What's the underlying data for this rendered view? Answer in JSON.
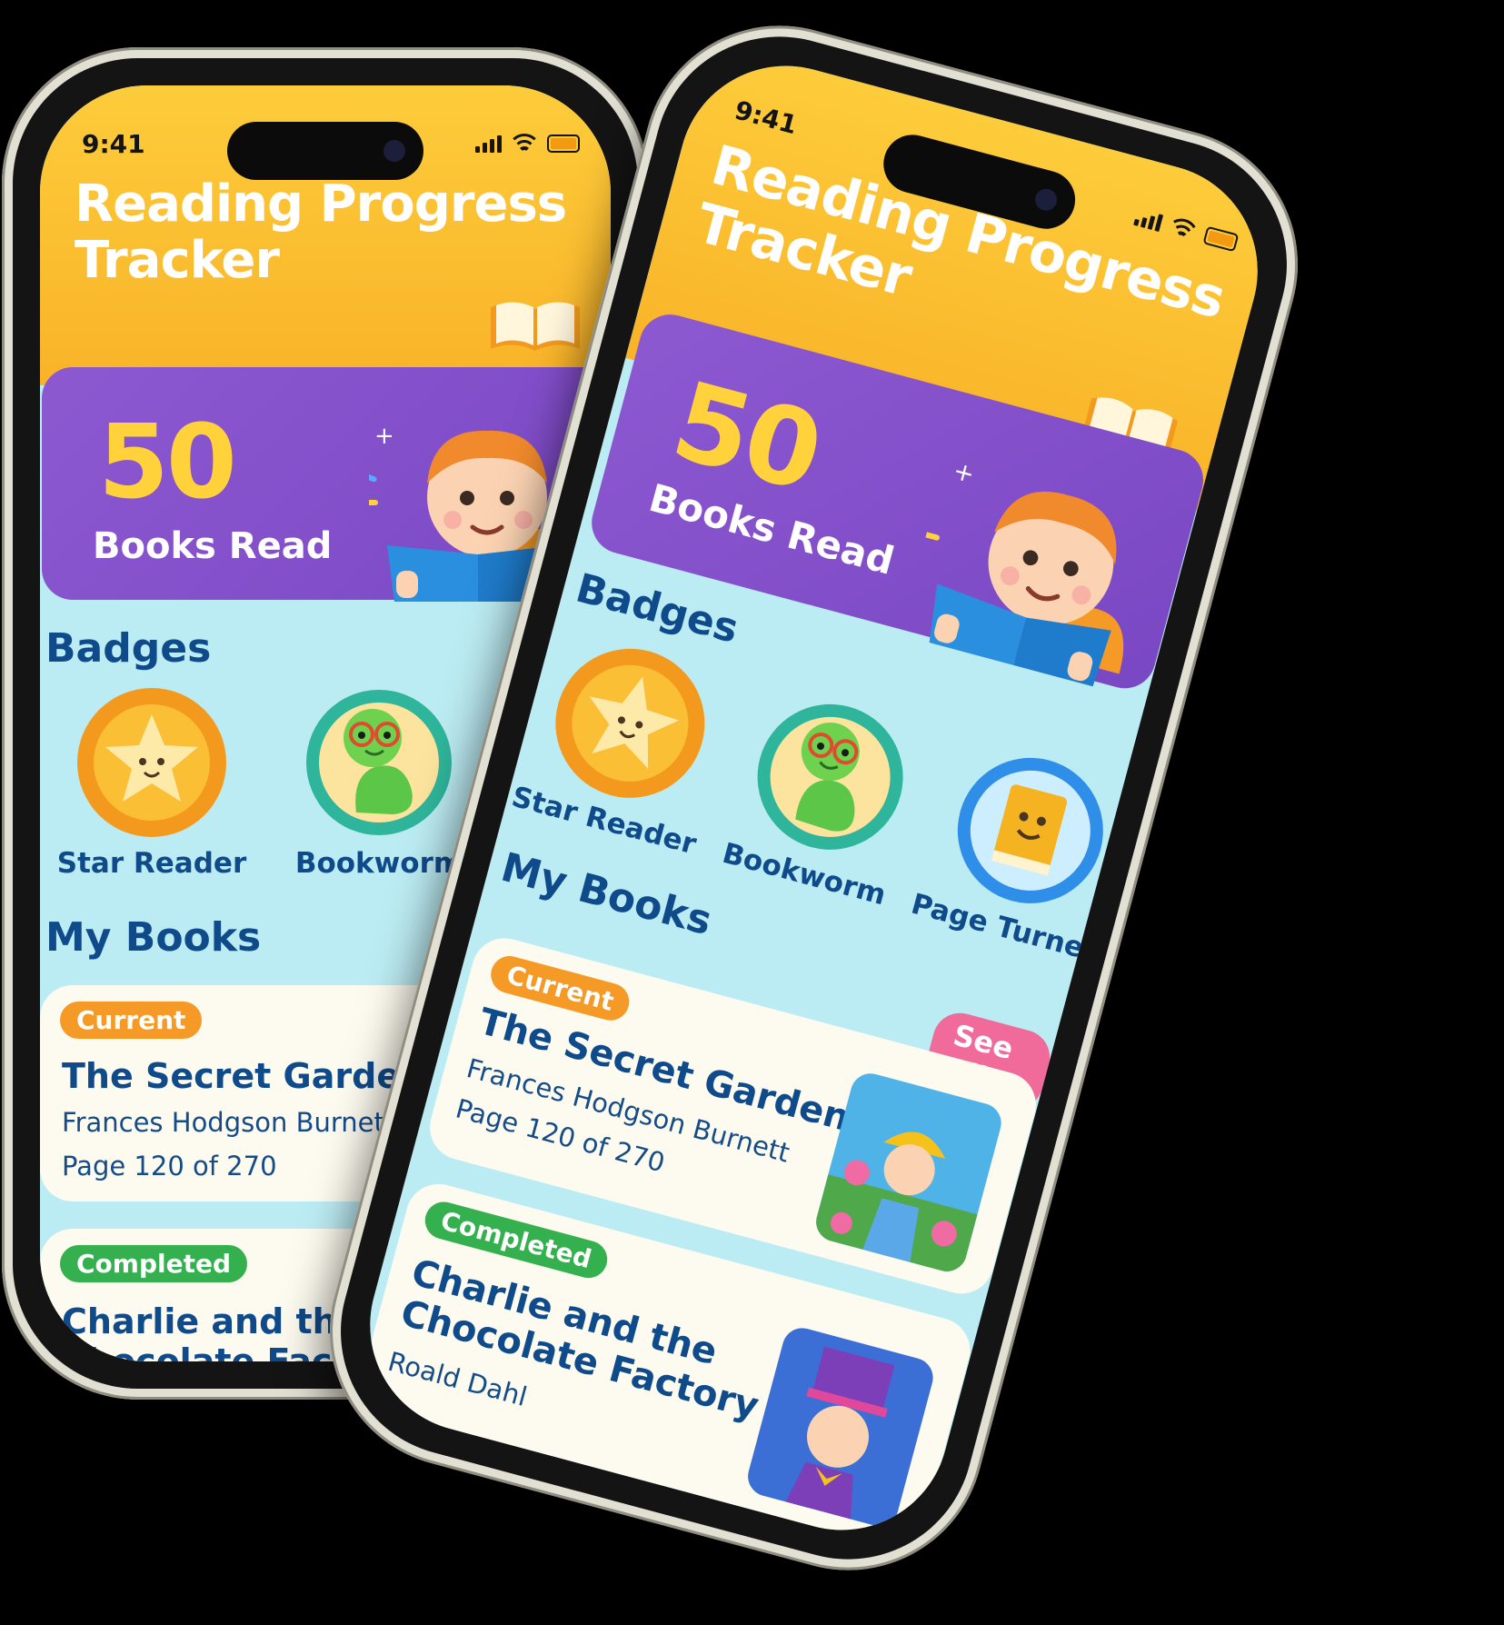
{
  "status_bar": {
    "time": "9:41"
  },
  "header": {
    "title": "Reading Progress Tracker"
  },
  "stats": {
    "books_read_count": "50",
    "books_read_label": "Books Read"
  },
  "badges": {
    "heading": "Badges",
    "items": [
      {
        "label": "Star Reader",
        "icon": "star-badge-icon"
      },
      {
        "label": "Bookworm",
        "icon": "bookworm-badge-icon"
      },
      {
        "label": "Page Turner",
        "icon": "book-badge-icon"
      }
    ]
  },
  "books": {
    "heading": "My Books",
    "see_all_label": "See All",
    "items": [
      {
        "status": "Current",
        "title": "The Secret Garden",
        "author": "Frances Hodgson Burnett",
        "progress": "Page 120 of 270"
      },
      {
        "status": "Completed",
        "title": "Charlie and the Chocolate Factory",
        "title_line1": "Charlie and the",
        "title_line2": "Chocolate Factory",
        "author": "Roald Dahl"
      }
    ]
  },
  "colors": {
    "header": "#fcc234",
    "stats_card": "#8655cd",
    "screen_bg": "#bcecf3",
    "heading": "#0f4a8a",
    "current_tag": "#f59a26",
    "completed_tag": "#34b14e",
    "see_all": "#f06a9a"
  }
}
